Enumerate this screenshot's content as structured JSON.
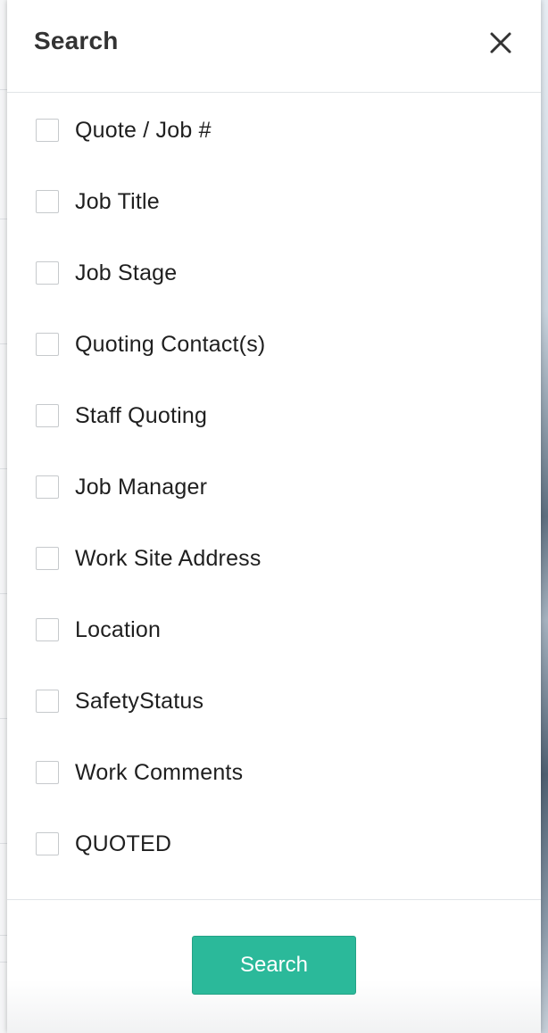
{
  "panel": {
    "title": "Search",
    "close_icon": "close-icon"
  },
  "options": [
    {
      "label": "Quote / Job #",
      "checked": false
    },
    {
      "label": "Job Title",
      "checked": false
    },
    {
      "label": "Job Stage",
      "checked": false
    },
    {
      "label": "Quoting Contact(s)",
      "checked": false
    },
    {
      "label": "Staff Quoting",
      "checked": false
    },
    {
      "label": "Job Manager",
      "checked": false
    },
    {
      "label": "Work Site Address",
      "checked": false
    },
    {
      "label": "Location",
      "checked": false
    },
    {
      "label": "SafetyStatus",
      "checked": false
    },
    {
      "label": "Work Comments",
      "checked": false
    },
    {
      "label": "QUOTED",
      "checked": false
    }
  ],
  "footer": {
    "search_label": "Search"
  },
  "colors": {
    "accent": "#2bb99a",
    "text": "#1f1f1f",
    "title": "#333333",
    "checkbox_border": "#c6c9cc",
    "divider": "#e1e4e7"
  }
}
